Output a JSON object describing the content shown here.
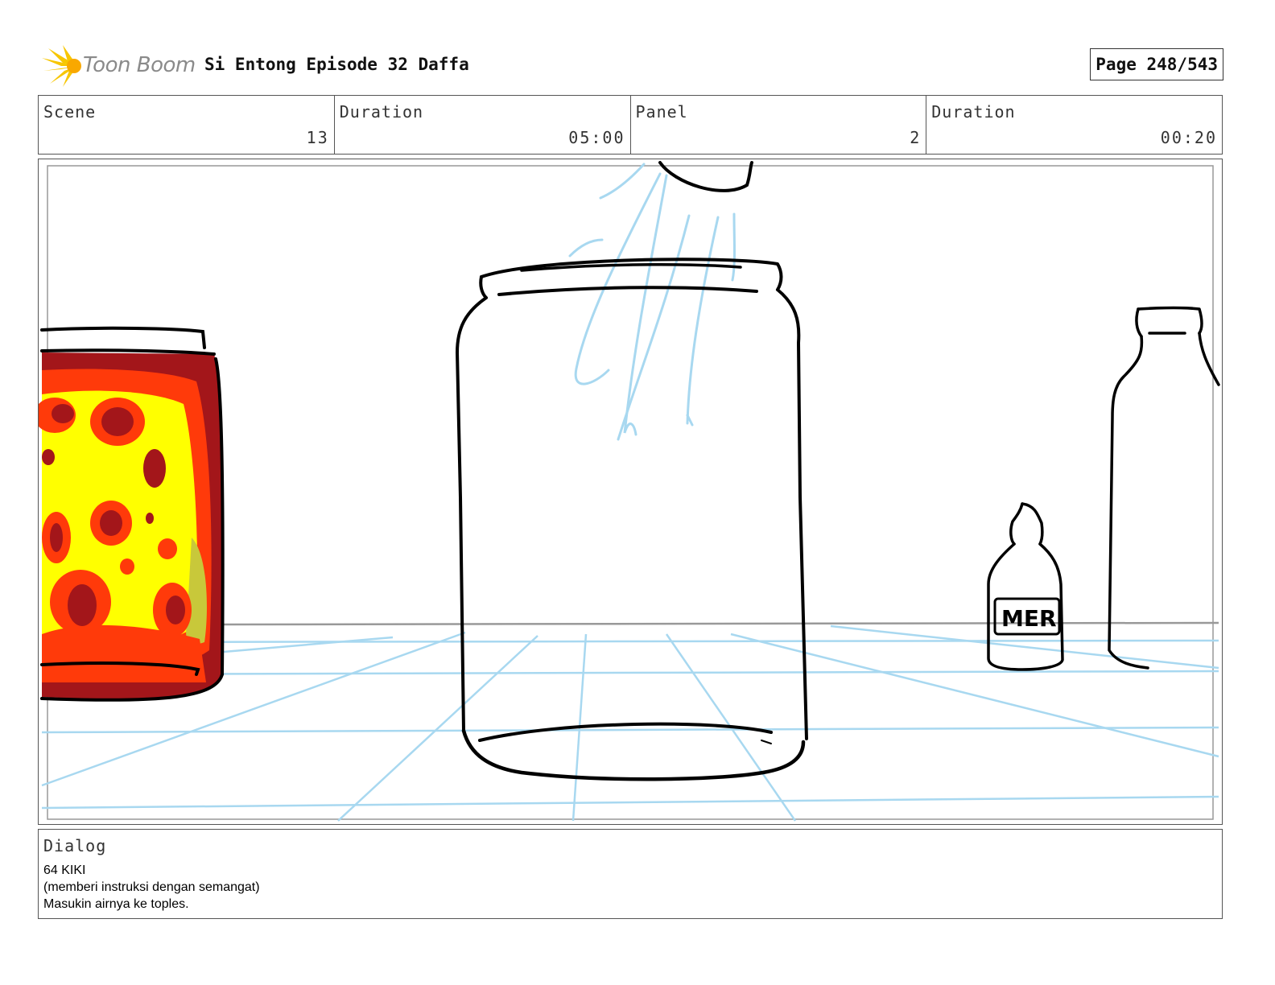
{
  "header": {
    "brand": "Toon Boom",
    "title": "Si Entong Episode 32 Daffa",
    "page": "Page 248/543"
  },
  "info": [
    {
      "label": "Scene",
      "value": "13"
    },
    {
      "label": "Duration",
      "value": "05:00"
    },
    {
      "label": "Panel",
      "value": "2"
    },
    {
      "label": "Duration",
      "value": "00:20"
    }
  ],
  "panel": {
    "bottle_label": "MER"
  },
  "dialog": {
    "label": "Dialog",
    "lines": [
      "64 KIKI",
      "(memberi instruksi dengan semangat)",
      "Masukin airnya ke toples."
    ]
  },
  "colors": {
    "sketch": "#000000",
    "guide": "#a8d8f0",
    "jar_red": "#a3161a",
    "jar_orange": "#ff3a0a",
    "jar_yellow": "#ffff00"
  }
}
